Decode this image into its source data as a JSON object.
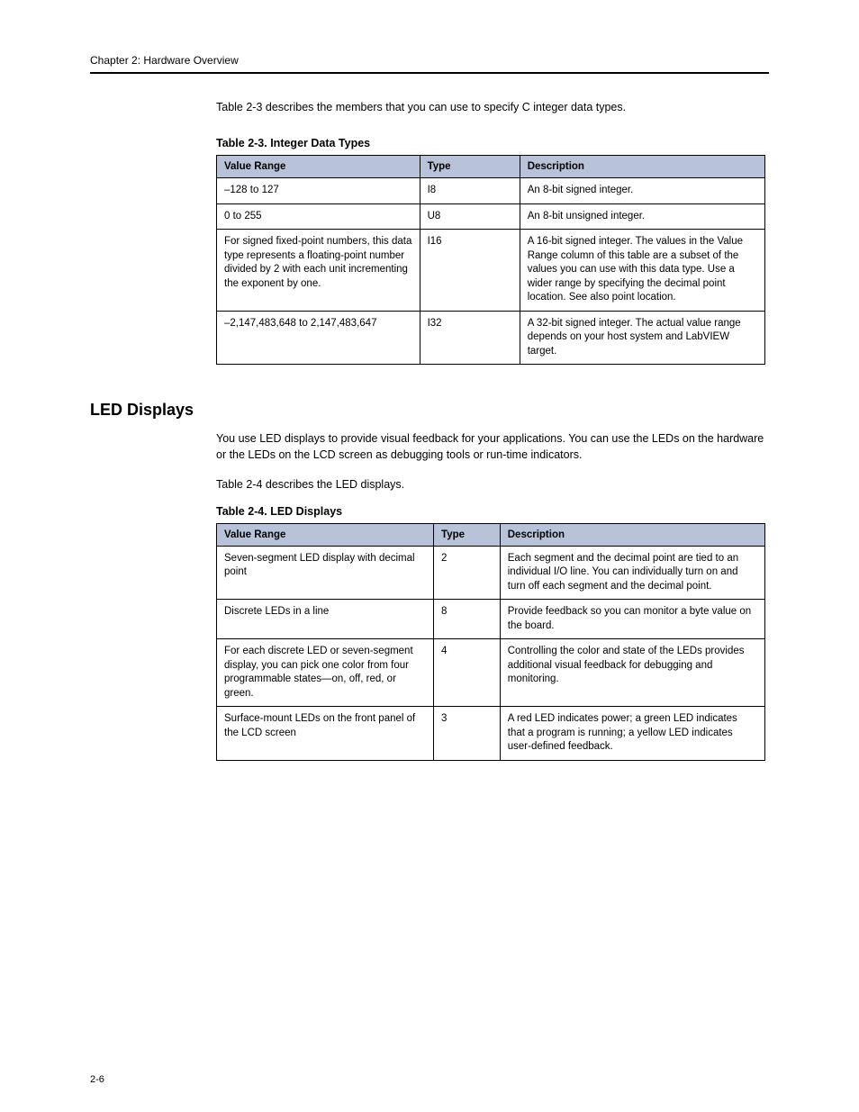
{
  "runningHead": "Chapter 2: Hardware Overview",
  "intro": "Table 2-3 describes the members that you can use to specify C integer data types.",
  "table1": {
    "caption": "Table 2-3.  Integer Data Types",
    "headers": [
      "Value Range",
      "Type",
      "Description"
    ],
    "rows": [
      {
        "range": "–128 to 127",
        "type": "I8",
        "desc": "An 8-bit signed integer."
      },
      {
        "range": "0 to 255",
        "type": "U8",
        "desc": "An 8-bit unsigned integer."
      },
      {
        "range": "For signed fixed-point numbers, this data type represents a floating-point number divided by 2 with each unit incrementing the exponent by one.",
        "type": "I16",
        "desc": "A 16-bit signed integer.\nThe values in the Value Range column of this table are a subset of the values you can use with this data type.\nUse a wider range by specifying the decimal point location.\nSee also point location."
      },
      {
        "range": "–2,147,483,648 to 2,147,483,647",
        "type": "I32",
        "desc": "A 32-bit signed integer.\nThe actual value range depends on your host system and LabVIEW target."
      }
    ]
  },
  "sectionTitle": "LED Displays",
  "body1": "You use LED displays to provide visual feedback for your applications. You can use the LEDs on the hardware or the LEDs on the LCD screen as debugging tools or run-time indicators.",
  "body2": "Table 2-4 describes the LED displays.",
  "table2": {
    "caption": "Table 2-4.  LED Displays",
    "headers": [
      "Value Range",
      "Type",
      "Description"
    ],
    "rows": [
      {
        "range": "Seven-segment LED display with decimal point",
        "type": "2",
        "desc": "Each segment and the decimal point are tied to an individual I/O line. You can individually turn on and turn off each segment and the decimal point."
      },
      {
        "range": "Discrete LEDs in a line",
        "type": "8",
        "desc": "Provide feedback so you can monitor a byte value on the board."
      },
      {
        "range": "For each discrete LED or seven-segment display, you can pick one color from four programmable states—on, off, red, or green.",
        "type": "4",
        "desc": "Controlling the color and state of the LEDs provides additional visual feedback for debugging and monitoring."
      },
      {
        "range": "Surface-mount LEDs on the front panel of the LCD screen",
        "type": "3",
        "desc": "A red LED indicates power; a green LED indicates that a program is running; a yellow LED indicates user-defined feedback."
      }
    ]
  },
  "pageNumber": "2-6"
}
